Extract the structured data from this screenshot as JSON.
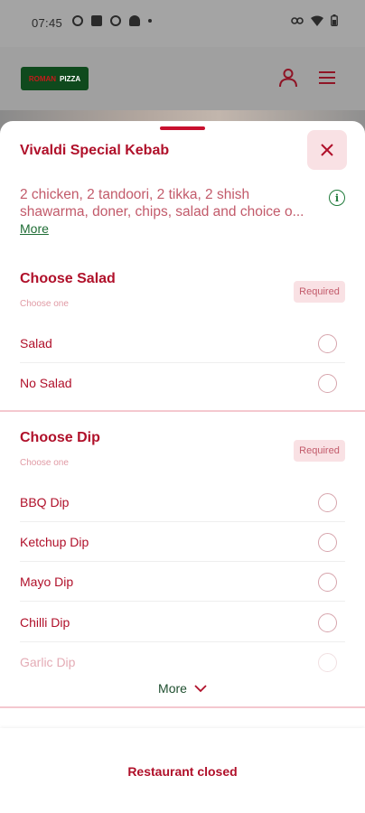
{
  "status_bar": {
    "time": "07:45"
  },
  "header": {
    "logo_text_1": "ROMAN",
    "logo_text_2": "PIZZA",
    "icons": [
      "user-icon",
      "menu-icon"
    ]
  },
  "sheet": {
    "title": "Vivaldi Special Kebab",
    "description_line1": "2 chicken, 2 tandoori, 2 tikka, 2 shish",
    "description_line2": "shawarma, doner, chips, salad and choice o...",
    "description_more": "More",
    "sections": [
      {
        "title": "Choose Salad",
        "subtitle": "Choose one",
        "badge": "Required",
        "options": [
          {
            "label": "Salad"
          },
          {
            "label": "No Salad"
          }
        ]
      },
      {
        "title": "Choose Dip",
        "subtitle": "Choose one",
        "badge": "Required",
        "options": [
          {
            "label": "BBQ Dip"
          },
          {
            "label": "Ketchup Dip"
          },
          {
            "label": "Mayo Dip"
          },
          {
            "label": "Chilli Dip"
          },
          {
            "label": "Garlic Dip"
          }
        ],
        "more_label": "More"
      }
    ]
  },
  "footer": {
    "status": "Restaurant closed"
  },
  "colors": {
    "accent": "#b0102a",
    "green": "#1f6d35",
    "badge_bg": "#f9e1e4"
  }
}
